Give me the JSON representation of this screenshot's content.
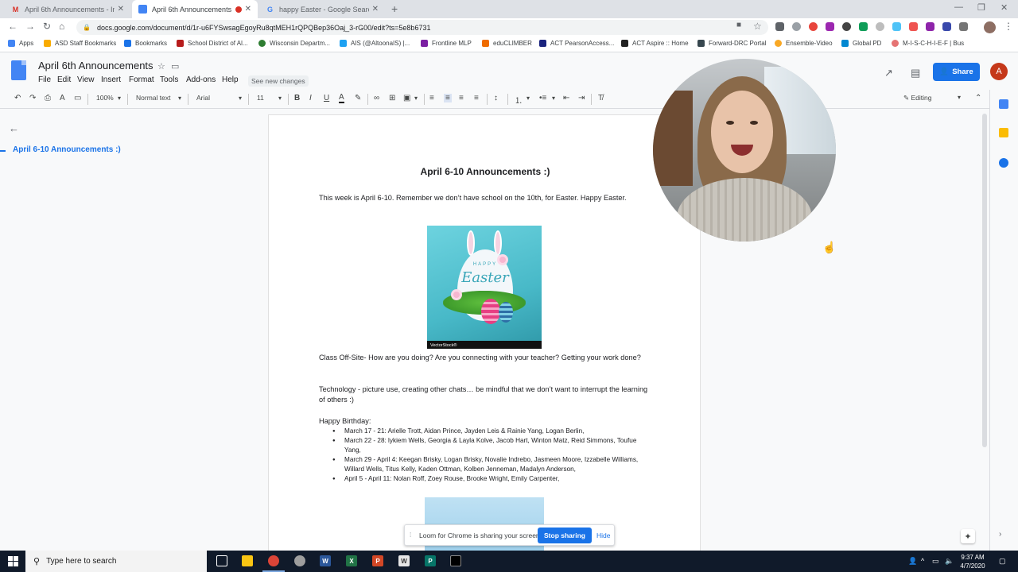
{
  "browser": {
    "tabs": [
      {
        "label": "April 6th Announcements - Invit",
        "icon": "gmail-icon",
        "active": false
      },
      {
        "label": "April 6th Announcements - G",
        "icon": "docs-icon",
        "active": true
      },
      {
        "label": "happy Easter - Google Search",
        "icon": "google-icon",
        "active": false
      }
    ],
    "url": "docs.google.com/document/d/1r-u6FYSwsagEgoyRu8qtMEH1rQPQBep36Oaj_3-rG00/edit?ts=5e8b6731",
    "bookmarks": [
      "Apps",
      "ASD Staff Bookmarks",
      "Bookmarks",
      "School District of Al...",
      "Wisconsin Departm...",
      "AIS (@AltoonaIS) |...",
      "Frontline MLP",
      "eduCLIMBER",
      "ACT PearsonAccess...",
      "ACT Aspire :: Home",
      "Forward-DRC Portal",
      "Ensemble-Video",
      "Global PD",
      "M-I-S-C-H-I-E-F | Bus"
    ]
  },
  "docs": {
    "title": "April 6th Announcements",
    "menu": [
      "File",
      "Edit",
      "View",
      "Insert",
      "Format",
      "Tools",
      "Add-ons",
      "Help"
    ],
    "see_changes": "See new changes",
    "share_label": "Share",
    "avatar_letter": "A",
    "toolbar": {
      "zoom": "100%",
      "style": "Normal text",
      "font": "Arial",
      "size": "11",
      "mode": "Editing"
    },
    "outline": {
      "items": [
        "April 6-10 Announcements :)"
      ]
    }
  },
  "document": {
    "heading": "April 6-10 Announcements :)",
    "para1": "This week is April 6-10.  Remember we don’t have school on the 10th, for Easter.  Happy Easter.",
    "image_caption": {
      "happy": "HAPPY",
      "easter": "Easter",
      "stock": "VectorStock®"
    },
    "para2": "Class Off-Site- How are you doing?  Are you connecting with your teacher?  Getting your work done?",
    "para3": "Technology - picture use, creating other chats… be mindful that we don’t want to interrupt the learning of others :)",
    "birthday_label": "Happy Birthday:",
    "birthdays": [
      "March 17 - 21:   Arielle Trott, Aidan Prince, Jayden Leis & Rainie Yang, Logan Berlin,",
      "March 22 - 28:   lykiem Wells, Georgia & Layla Kolve, Jacob Hart, Winton Matz, Reid Simmons, Toufue Yang,",
      "March 29 - April 4:  Keegan Brisky, Logan Brisky, Novalie Indrebo, Jasmeen Moore, Izzabelle Williams, Willard Wells, Titus Kelly, Kaden Ottman, Kolben Jenneman, Madalyn Anderson,",
      "April 5 - April 11:  Nolan Roff, Zoey Rouse, Brooke Wright, Emily Carpenter,"
    ]
  },
  "loom": {
    "message": "Loom for Chrome is sharing your screen.",
    "stop_label": "Stop sharing",
    "hide_label": "Hide"
  },
  "taskbar": {
    "search_placeholder": "Type here to search",
    "time": "9:37 AM",
    "date": "4/7/2020"
  }
}
